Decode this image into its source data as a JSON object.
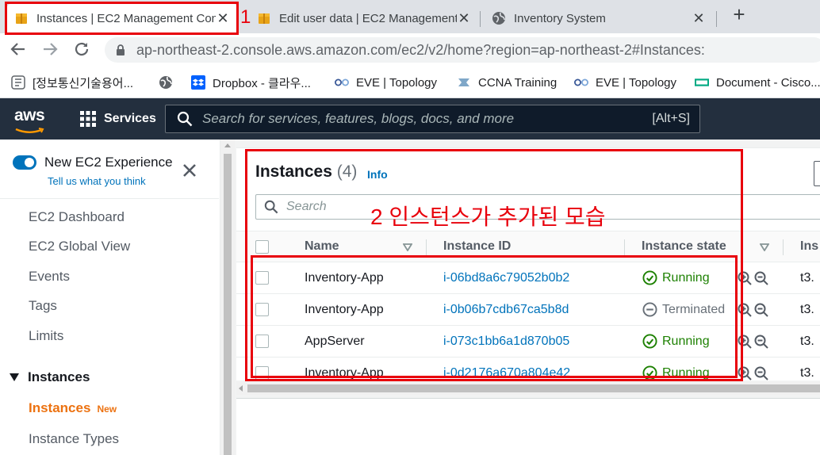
{
  "browser": {
    "tabs": [
      {
        "title": "Instances | EC2 Management Console",
        "close": "✕"
      },
      {
        "title": "Edit user data | EC2 Management Console",
        "close": "✕"
      },
      {
        "title": "Inventory System",
        "close": "✕"
      }
    ],
    "new_tab": "+",
    "url": "ap-northeast-2.console.aws.amazon.com/ec2/v2/home?region=ap-northeast-2#Instances:",
    "bookmarks": [
      {
        "label": "[정보통신기술용어..."
      },
      {
        "label": ""
      },
      {
        "label": "Dropbox - 클라우..."
      },
      {
        "label": "EVE | Topology"
      },
      {
        "label": "CCNA Training"
      },
      {
        "label": "EVE | Topology"
      },
      {
        "label": "Document - Cisco..."
      }
    ]
  },
  "aws_header": {
    "logo_text": "aws",
    "services_label": "Services",
    "search_placeholder": "Search for services, features, blogs, docs, and more",
    "search_shortcut": "[Alt+S]"
  },
  "sidebar": {
    "new_experience_title": "New EC2 Experience",
    "new_experience_link": "Tell us what you think",
    "items": [
      {
        "label": "EC2 Dashboard"
      },
      {
        "label": "EC2 Global View"
      },
      {
        "label": "Events"
      },
      {
        "label": "Tags"
      },
      {
        "label": "Limits"
      }
    ],
    "section_label": "Instances",
    "section_items": [
      {
        "label": "Instances",
        "badge": "New"
      },
      {
        "label": "Instance Types"
      }
    ]
  },
  "main": {
    "title": "Instances",
    "count": "(4)",
    "info_label": "Info",
    "search_placeholder": "Search",
    "columns": [
      "Name",
      "Instance ID",
      "Instance state",
      "Ins"
    ],
    "rows": [
      {
        "name": "Inventory-App",
        "id": "i-06bd8a6c79052b0b2",
        "state": "Running",
        "type": "t3."
      },
      {
        "name": "Inventory-App",
        "id": "i-0b06b7cdb67ca5b8d",
        "state": "Terminated",
        "type": "t3."
      },
      {
        "name": "AppServer",
        "id": "i-073c1bb6a1d870b05",
        "state": "Running",
        "type": "t3."
      },
      {
        "name": "Inventory-App",
        "id": "i-0d2176a670a804e42",
        "state": "Running",
        "type": "t3."
      }
    ]
  },
  "annotations": {
    "marker_1": "1",
    "marker_2": "2 인스턴스가 추가된 모습"
  },
  "colors": {
    "aws_header": "#232f3e",
    "link_blue": "#0073bb",
    "running_green": "#1d8102",
    "active_orange": "#ec7211",
    "annotation_red": "#e8000b"
  }
}
